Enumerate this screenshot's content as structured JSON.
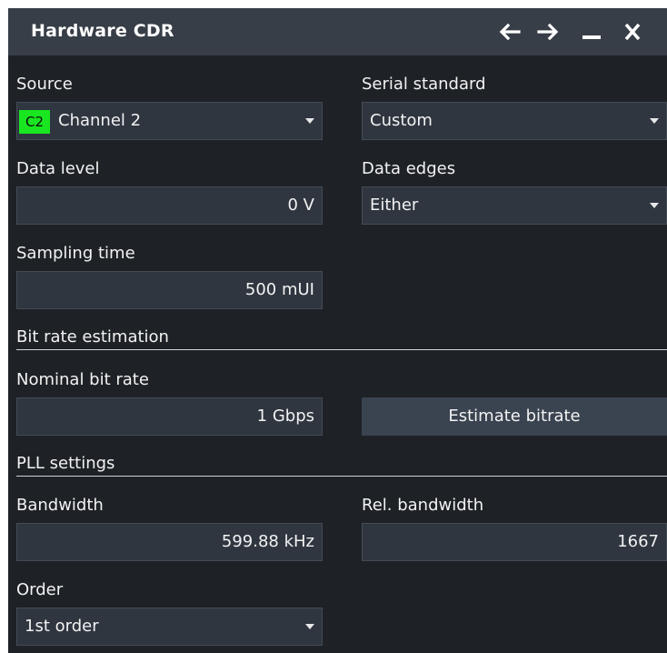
{
  "window": {
    "title": "Hardware CDR",
    "buttons": [
      "back-icon",
      "forward-icon",
      "minimize-icon",
      "close-icon"
    ]
  },
  "source": {
    "label": "Source",
    "channel_badge": "C2",
    "value": "Channel 2",
    "badge_color": "#19e620"
  },
  "serial_standard": {
    "label": "Serial standard",
    "value": "Custom"
  },
  "data_level": {
    "label": "Data level",
    "value": "0 V"
  },
  "data_edges": {
    "label": "Data edges",
    "value": "Either"
  },
  "sampling_time": {
    "label": "Sampling time",
    "value": "500 mUI"
  },
  "bit_rate_estimation": {
    "section_title": "Bit rate estimation",
    "nominal_label": "Nominal bit rate",
    "nominal_value": "1 Gbps",
    "estimate_button": "Estimate bitrate"
  },
  "pll_settings": {
    "section_title": "PLL settings",
    "bandwidth_label": "Bandwidth",
    "bandwidth_value": "599.88 kHz",
    "rel_bandwidth_label": "Rel. bandwidth",
    "rel_bandwidth_value": "1667",
    "order_label": "Order",
    "order_value": "1st order"
  },
  "colors": {
    "background": "#1e2227",
    "titlebar": "#373e47",
    "field": "#2f3640",
    "button": "#3a4350",
    "text": "#f2f2f2"
  }
}
